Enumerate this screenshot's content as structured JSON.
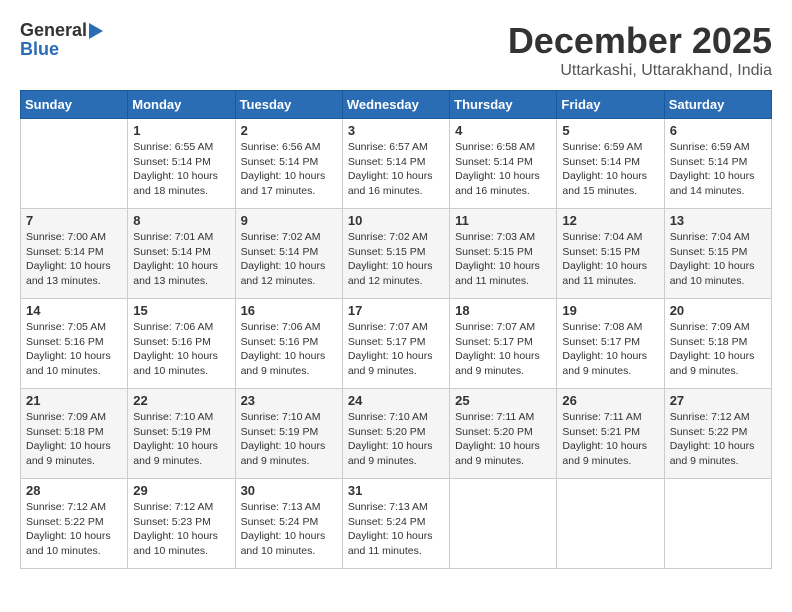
{
  "logo": {
    "general": "General",
    "blue": "Blue"
  },
  "title": "December 2025",
  "location": "Uttarkashi, Uttarakhand, India",
  "days_of_week": [
    "Sunday",
    "Monday",
    "Tuesday",
    "Wednesday",
    "Thursday",
    "Friday",
    "Saturday"
  ],
  "weeks": [
    [
      {
        "day": "",
        "sunrise": "",
        "sunset": "",
        "daylight": ""
      },
      {
        "day": "1",
        "sunrise": "Sunrise: 6:55 AM",
        "sunset": "Sunset: 5:14 PM",
        "daylight": "Daylight: 10 hours and 18 minutes."
      },
      {
        "day": "2",
        "sunrise": "Sunrise: 6:56 AM",
        "sunset": "Sunset: 5:14 PM",
        "daylight": "Daylight: 10 hours and 17 minutes."
      },
      {
        "day": "3",
        "sunrise": "Sunrise: 6:57 AM",
        "sunset": "Sunset: 5:14 PM",
        "daylight": "Daylight: 10 hours and 16 minutes."
      },
      {
        "day": "4",
        "sunrise": "Sunrise: 6:58 AM",
        "sunset": "Sunset: 5:14 PM",
        "daylight": "Daylight: 10 hours and 16 minutes."
      },
      {
        "day": "5",
        "sunrise": "Sunrise: 6:59 AM",
        "sunset": "Sunset: 5:14 PM",
        "daylight": "Daylight: 10 hours and 15 minutes."
      },
      {
        "day": "6",
        "sunrise": "Sunrise: 6:59 AM",
        "sunset": "Sunset: 5:14 PM",
        "daylight": "Daylight: 10 hours and 14 minutes."
      }
    ],
    [
      {
        "day": "7",
        "sunrise": "Sunrise: 7:00 AM",
        "sunset": "Sunset: 5:14 PM",
        "daylight": "Daylight: 10 hours and 13 minutes."
      },
      {
        "day": "8",
        "sunrise": "Sunrise: 7:01 AM",
        "sunset": "Sunset: 5:14 PM",
        "daylight": "Daylight: 10 hours and 13 minutes."
      },
      {
        "day": "9",
        "sunrise": "Sunrise: 7:02 AM",
        "sunset": "Sunset: 5:14 PM",
        "daylight": "Daylight: 10 hours and 12 minutes."
      },
      {
        "day": "10",
        "sunrise": "Sunrise: 7:02 AM",
        "sunset": "Sunset: 5:15 PM",
        "daylight": "Daylight: 10 hours and 12 minutes."
      },
      {
        "day": "11",
        "sunrise": "Sunrise: 7:03 AM",
        "sunset": "Sunset: 5:15 PM",
        "daylight": "Daylight: 10 hours and 11 minutes."
      },
      {
        "day": "12",
        "sunrise": "Sunrise: 7:04 AM",
        "sunset": "Sunset: 5:15 PM",
        "daylight": "Daylight: 10 hours and 11 minutes."
      },
      {
        "day": "13",
        "sunrise": "Sunrise: 7:04 AM",
        "sunset": "Sunset: 5:15 PM",
        "daylight": "Daylight: 10 hours and 10 minutes."
      }
    ],
    [
      {
        "day": "14",
        "sunrise": "Sunrise: 7:05 AM",
        "sunset": "Sunset: 5:16 PM",
        "daylight": "Daylight: 10 hours and 10 minutes."
      },
      {
        "day": "15",
        "sunrise": "Sunrise: 7:06 AM",
        "sunset": "Sunset: 5:16 PM",
        "daylight": "Daylight: 10 hours and 10 minutes."
      },
      {
        "day": "16",
        "sunrise": "Sunrise: 7:06 AM",
        "sunset": "Sunset: 5:16 PM",
        "daylight": "Daylight: 10 hours and 9 minutes."
      },
      {
        "day": "17",
        "sunrise": "Sunrise: 7:07 AM",
        "sunset": "Sunset: 5:17 PM",
        "daylight": "Daylight: 10 hours and 9 minutes."
      },
      {
        "day": "18",
        "sunrise": "Sunrise: 7:07 AM",
        "sunset": "Sunset: 5:17 PM",
        "daylight": "Daylight: 10 hours and 9 minutes."
      },
      {
        "day": "19",
        "sunrise": "Sunrise: 7:08 AM",
        "sunset": "Sunset: 5:17 PM",
        "daylight": "Daylight: 10 hours and 9 minutes."
      },
      {
        "day": "20",
        "sunrise": "Sunrise: 7:09 AM",
        "sunset": "Sunset: 5:18 PM",
        "daylight": "Daylight: 10 hours and 9 minutes."
      }
    ],
    [
      {
        "day": "21",
        "sunrise": "Sunrise: 7:09 AM",
        "sunset": "Sunset: 5:18 PM",
        "daylight": "Daylight: 10 hours and 9 minutes."
      },
      {
        "day": "22",
        "sunrise": "Sunrise: 7:10 AM",
        "sunset": "Sunset: 5:19 PM",
        "daylight": "Daylight: 10 hours and 9 minutes."
      },
      {
        "day": "23",
        "sunrise": "Sunrise: 7:10 AM",
        "sunset": "Sunset: 5:19 PM",
        "daylight": "Daylight: 10 hours and 9 minutes."
      },
      {
        "day": "24",
        "sunrise": "Sunrise: 7:10 AM",
        "sunset": "Sunset: 5:20 PM",
        "daylight": "Daylight: 10 hours and 9 minutes."
      },
      {
        "day": "25",
        "sunrise": "Sunrise: 7:11 AM",
        "sunset": "Sunset: 5:20 PM",
        "daylight": "Daylight: 10 hours and 9 minutes."
      },
      {
        "day": "26",
        "sunrise": "Sunrise: 7:11 AM",
        "sunset": "Sunset: 5:21 PM",
        "daylight": "Daylight: 10 hours and 9 minutes."
      },
      {
        "day": "27",
        "sunrise": "Sunrise: 7:12 AM",
        "sunset": "Sunset: 5:22 PM",
        "daylight": "Daylight: 10 hours and 9 minutes."
      }
    ],
    [
      {
        "day": "28",
        "sunrise": "Sunrise: 7:12 AM",
        "sunset": "Sunset: 5:22 PM",
        "daylight": "Daylight: 10 hours and 10 minutes."
      },
      {
        "day": "29",
        "sunrise": "Sunrise: 7:12 AM",
        "sunset": "Sunset: 5:23 PM",
        "daylight": "Daylight: 10 hours and 10 minutes."
      },
      {
        "day": "30",
        "sunrise": "Sunrise: 7:13 AM",
        "sunset": "Sunset: 5:24 PM",
        "daylight": "Daylight: 10 hours and 10 minutes."
      },
      {
        "day": "31",
        "sunrise": "Sunrise: 7:13 AM",
        "sunset": "Sunset: 5:24 PM",
        "daylight": "Daylight: 10 hours and 11 minutes."
      },
      {
        "day": "",
        "sunrise": "",
        "sunset": "",
        "daylight": ""
      },
      {
        "day": "",
        "sunrise": "",
        "sunset": "",
        "daylight": ""
      },
      {
        "day": "",
        "sunrise": "",
        "sunset": "",
        "daylight": ""
      }
    ]
  ]
}
